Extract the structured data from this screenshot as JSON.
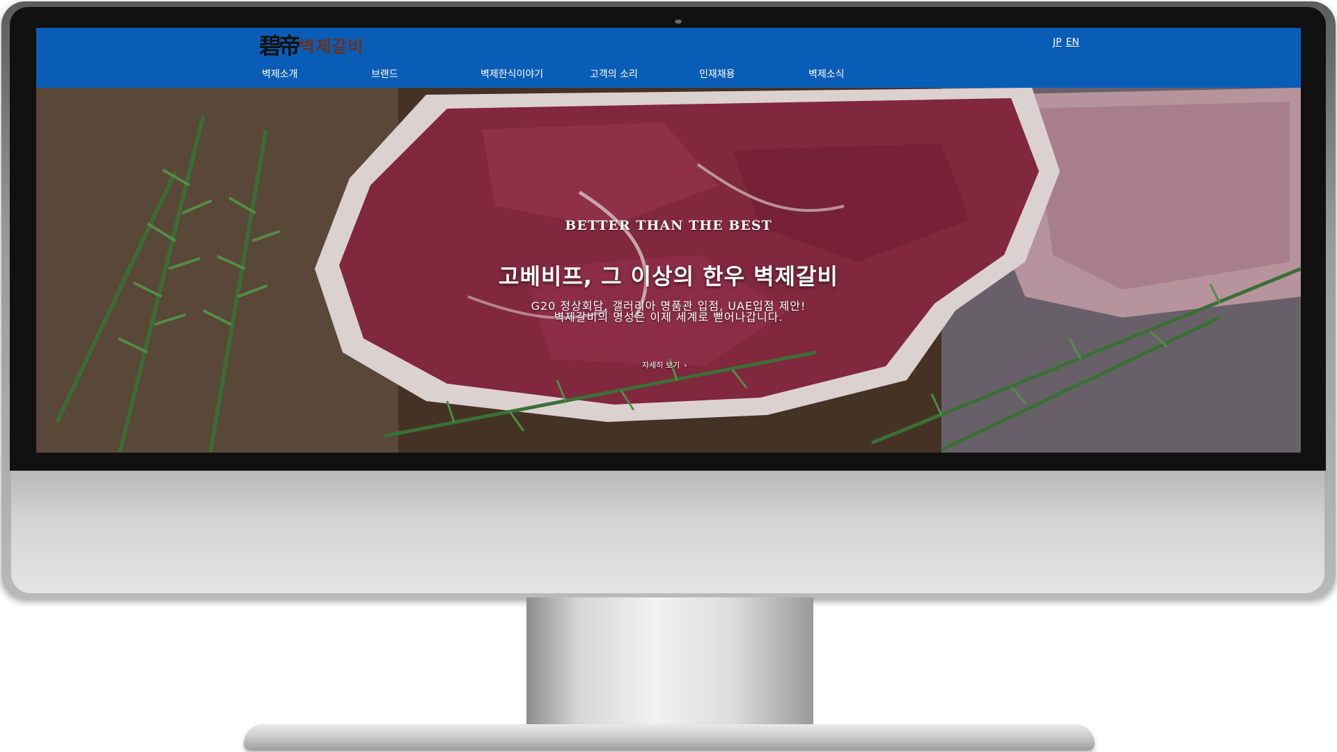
{
  "site": {
    "logo_mark": "碧帝",
    "logo_text": "벽제갈비",
    "languages": [
      "JP",
      "EN"
    ],
    "nav": [
      "벽제소개",
      "브랜드",
      "벽제한식이야기",
      "고객의 소리",
      "인재채용",
      "벽제소식"
    ]
  },
  "hero": {
    "subtitle": "BETTER THAN THE BEST",
    "title": "고베비프, 그 이상의 한우 벽제갈비",
    "desc_line1": "G20 정상회담, 갤러리아 명품관 입점, UAE입점 제안!",
    "desc_line2": "벽제갈비의 명성은 이제 세계로 뻗어나갑니다.",
    "more_label": "자세히 보기",
    "more_icon": "chevron-right-icon"
  },
  "colors": {
    "header_bg": "#0a5db7",
    "logo_text": "#6a3020"
  }
}
